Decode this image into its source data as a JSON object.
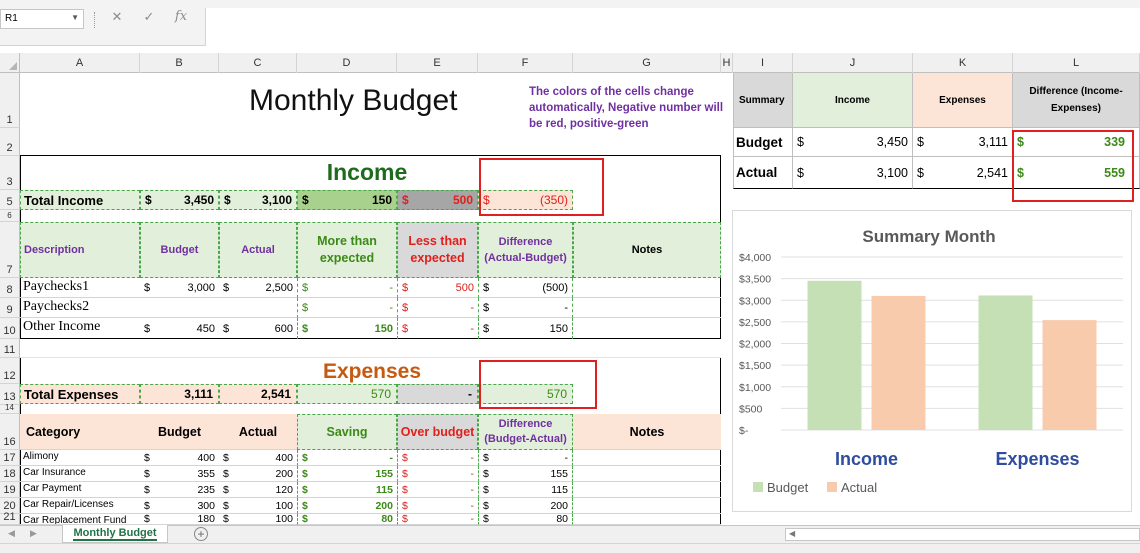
{
  "formula_bar": {
    "name_box": "R1",
    "cancel_icon": "✕",
    "enter_icon": "✓",
    "fx_label": "fx",
    "formula": ""
  },
  "columns": [
    "A",
    "B",
    "C",
    "D",
    "E",
    "F",
    "G",
    "H",
    "I",
    "J",
    "K",
    "L"
  ],
  "rows": [
    "1",
    "2",
    "3",
    "5",
    "6",
    "7",
    "8",
    "9",
    "10",
    "11",
    "12",
    "13",
    "14",
    "16",
    "17",
    "18",
    "19",
    "20",
    "21"
  ],
  "sheet": {
    "title": "Monthly Budget",
    "note": "The colors of the cells change automatically, Negative number will be red, positive-green",
    "income": {
      "title": "Income",
      "total_label": "Total Income",
      "total": {
        "budget": "3,450",
        "actual": "3,100",
        "more": "150",
        "less": "500",
        "diff": "(350)"
      },
      "headers": {
        "desc": "Description",
        "budget": "Budget",
        "actual": "Actual",
        "more": "More than expected",
        "less": "Less than expected",
        "diff": "Difference (Actual-Budget)",
        "notes": "Notes"
      },
      "rows": [
        {
          "desc": "Paychecks1",
          "budget": "3,000",
          "actual": "2,500",
          "more": "-",
          "less": "500",
          "diff": "(500)"
        },
        {
          "desc": "Paychecks2",
          "budget": "",
          "actual": "",
          "more": "-",
          "less": "-",
          "diff": "-"
        },
        {
          "desc": "Other Income",
          "budget": "450",
          "actual": "600",
          "more": "150",
          "less": "-",
          "diff": "150"
        }
      ]
    },
    "expenses": {
      "title": "Expenses",
      "total_label": "Total Expenses",
      "total": {
        "budget": "3,111",
        "actual": "2,541",
        "saving": "570",
        "over": "-",
        "diff": "570"
      },
      "headers": {
        "cat": "Category",
        "budget": "Budget",
        "actual": "Actual",
        "saving": "Saving",
        "over": "Over budget",
        "diff": "Difference (Budget-Actual)",
        "notes": "Notes"
      },
      "rows": [
        {
          "cat": "Alimony",
          "budget": "400",
          "actual": "400",
          "saving": "-",
          "over": "-",
          "diff": "-"
        },
        {
          "cat": "Car Insurance",
          "budget": "355",
          "actual": "200",
          "saving": "155",
          "over": "-",
          "diff": "155"
        },
        {
          "cat": "Car Payment",
          "budget": "235",
          "actual": "120",
          "saving": "115",
          "over": "-",
          "diff": "115"
        },
        {
          "cat": "Car Repair/Licenses",
          "budget": "300",
          "actual": "100",
          "saving": "200",
          "over": "-",
          "diff": "200"
        },
        {
          "cat": "Car Replacement Fund",
          "budget": "180",
          "actual": "100",
          "saving": "80",
          "over": "-",
          "diff": "80"
        }
      ]
    },
    "currency": "$"
  },
  "summary": {
    "headers": {
      "summary": "Summary",
      "income": "Income",
      "expenses": "Expenses",
      "difference": "Difference (Income-Expenses)"
    },
    "rows": [
      {
        "label": "Budget",
        "income": "3,450",
        "expenses": "3,111",
        "difference": "339"
      },
      {
        "label": "Actual",
        "income": "3,100",
        "expenses": "2,541",
        "difference": "559"
      }
    ]
  },
  "chart_data": {
    "type": "bar",
    "title": "Summary Month",
    "categories": [
      "Income",
      "Expenses"
    ],
    "series": [
      {
        "name": "Budget",
        "values": [
          3450,
          3111
        ],
        "color": "#c5e0b4"
      },
      {
        "name": "Actual",
        "values": [
          3100,
          2541
        ],
        "color": "#f8cbad"
      }
    ],
    "y_ticks": [
      "$-",
      "$500",
      "$1,000",
      "$1,500",
      "$2,000",
      "$2,500",
      "$3,000",
      "$3,500",
      "$4,000"
    ],
    "ylim": [
      0,
      4000
    ],
    "grid": true,
    "legend": "bottom-left"
  },
  "tabs": {
    "active": "Monthly Budget",
    "add_icon": "+"
  },
  "colors": {
    "green_fill": "#e2efda",
    "orange_fill": "#fce4d6",
    "grey_fill": "#d9d9d9",
    "bright_green": "#a9d18e",
    "dark_grey": "#a6a6a6",
    "income_green": "#1e6b1e",
    "expenses_orange": "#c55a11",
    "chart_label_blue": "#2f4c9e"
  }
}
